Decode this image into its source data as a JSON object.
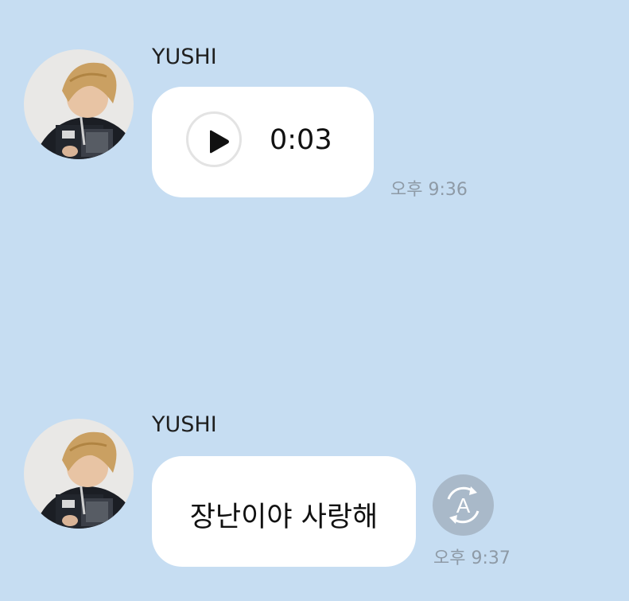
{
  "messages": [
    {
      "sender": "YUSHI",
      "type": "voice",
      "duration": "0:03",
      "time": "오후 9:36"
    },
    {
      "sender": "YUSHI",
      "type": "text",
      "text": "장난이야 사랑해",
      "translate_icon_letter": "A",
      "time": "오후 9:37"
    }
  ],
  "icons": {
    "play": "play-icon",
    "translate": "translate-icon"
  },
  "colors": {
    "background": "#c6ddf2",
    "bubble": "#ffffff",
    "timestamp": "#8e9aa6",
    "translate_button": "#a9b9c9"
  }
}
